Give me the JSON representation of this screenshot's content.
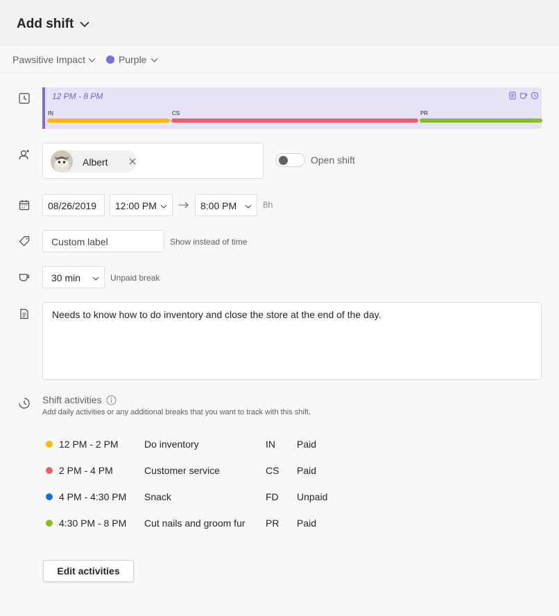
{
  "header": {
    "title": "Add shift"
  },
  "subbar": {
    "team": "Pawsitive Impact",
    "theme": "Purple",
    "theme_color": "#7b70d5"
  },
  "timebar": {
    "time_range": "12 PM - 8 PM",
    "segments": [
      {
        "code": "IN",
        "color": "#ffb900"
      },
      {
        "code": "CS",
        "color": "#e8606f"
      },
      {
        "code": "PR",
        "color": "#8cbd18"
      }
    ]
  },
  "assignee": {
    "name": "Albert",
    "open_shift_label": "Open shift",
    "open_shift_on": false
  },
  "schedule": {
    "date": "08/26/2019",
    "start_time": "12:00 PM",
    "end_time": "8:00 PM",
    "duration": "8h"
  },
  "label": {
    "placeholder": "Custom label",
    "hint": "Show instead of time"
  },
  "break": {
    "value": "30 min",
    "hint": "Unpaid break"
  },
  "notes": {
    "text": "Needs to know how to do inventory and close the store at the end of the day."
  },
  "activities": {
    "title": "Shift activities",
    "description": "Add daily activities or any additional breaks that you want to track with this shift.",
    "items": [
      {
        "time": "12 PM - 2 PM",
        "name": "Do inventory",
        "code": "IN",
        "pay": "Paid",
        "color": "#ffb900"
      },
      {
        "time": "2 PM - 4 PM",
        "name": "Customer service",
        "code": "CS",
        "pay": "Paid",
        "color": "#e8606f"
      },
      {
        "time": "4 PM - 4:30 PM",
        "name": "Snack",
        "code": "FD",
        "pay": "Unpaid",
        "color": "#1570d4"
      },
      {
        "time": "4:30 PM - 8 PM",
        "name": "Cut nails and groom fur",
        "code": "PR",
        "pay": "Paid",
        "color": "#8cbd18"
      }
    ],
    "edit_label": "Edit activities"
  }
}
